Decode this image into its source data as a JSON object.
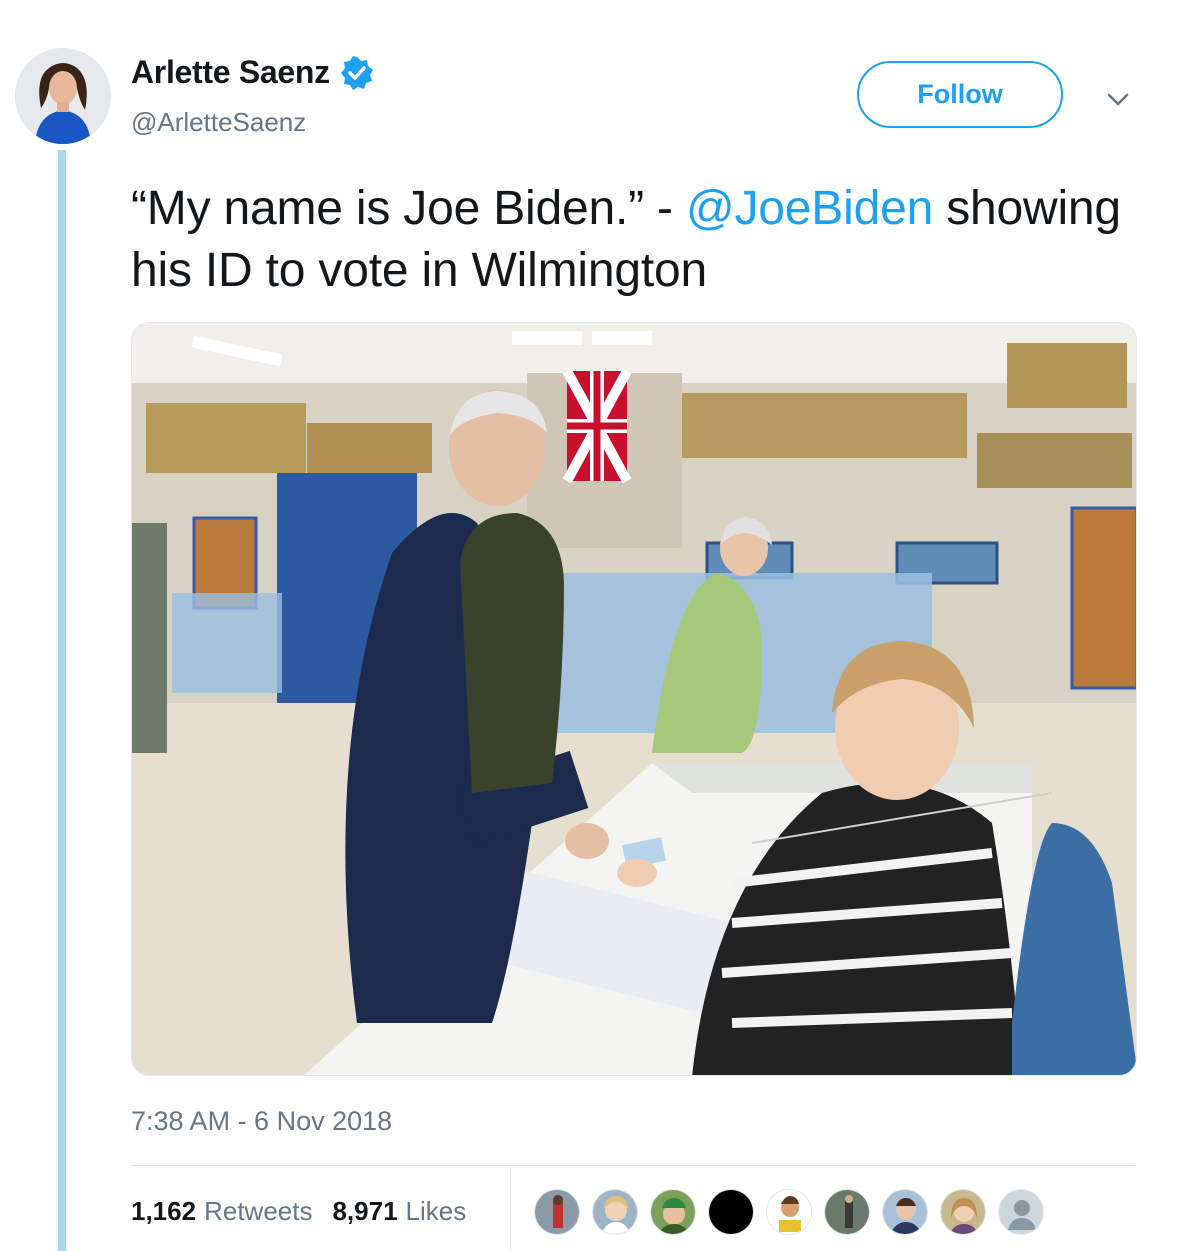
{
  "author": {
    "display_name": "Arlette Saenz",
    "handle": "@ArletteSaenz",
    "verified": true
  },
  "actions": {
    "follow_label": "Follow"
  },
  "tweet": {
    "text_before": "“My name is Joe Biden.” - ",
    "mention": "@JoeBiden",
    "text_after": " showing his ID to vote in Wilmington",
    "timestamp": "7:38 AM - 6 Nov 2018"
  },
  "stats": {
    "retweets_count": "1,162",
    "retweets_label": "Retweets",
    "likes_count": "8,971",
    "likes_label": "Likes"
  },
  "colors": {
    "accent": "#1da1f2",
    "secondary_text": "#657786",
    "thread_line": "#aad8f2"
  },
  "icons": [
    "verified-badge-icon",
    "chevron-down-icon",
    "default-avatar-icon"
  ]
}
